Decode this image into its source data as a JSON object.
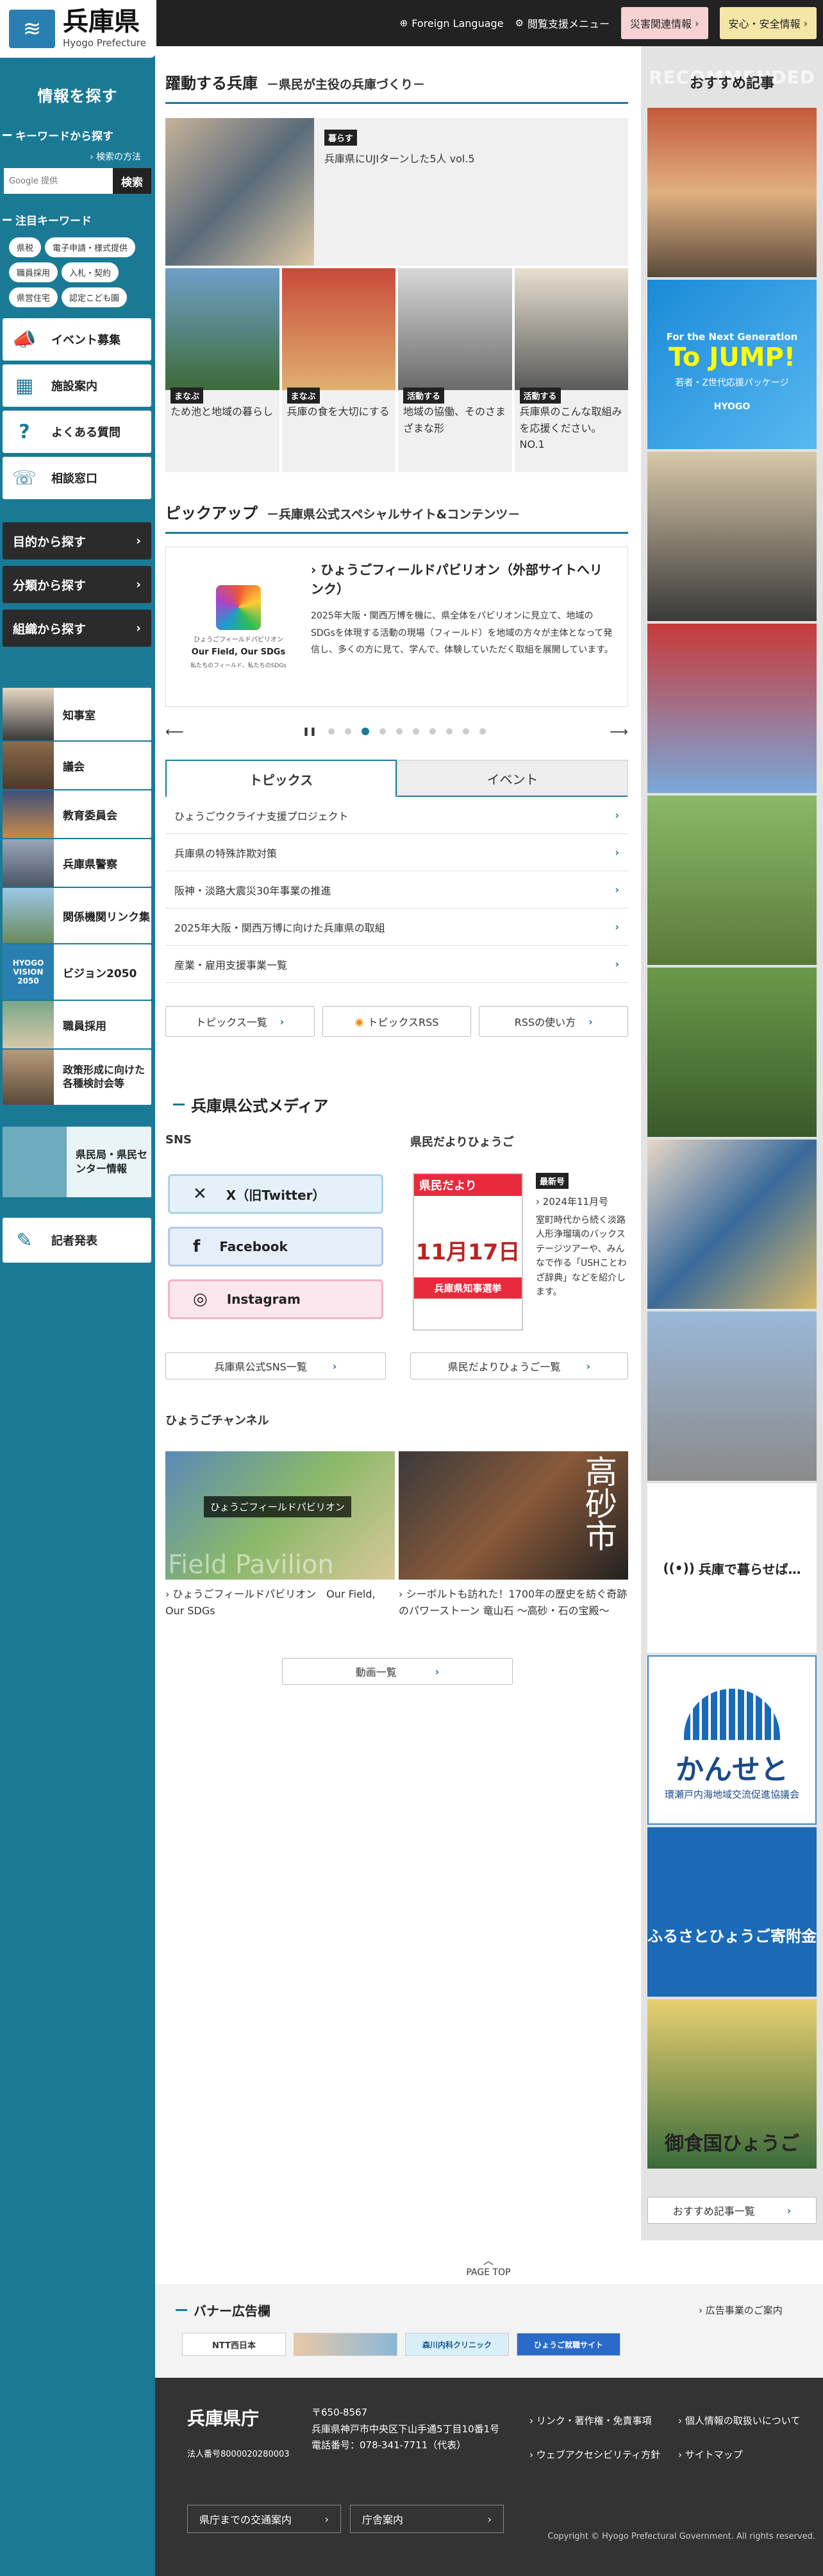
{
  "header": {
    "logo_title": "兵庫県",
    "logo_sub": "Hyogo Prefecture",
    "foreign_language": "Foreign Language",
    "reading_menu": "閲覧支援メニュー",
    "disaster_btn": "災害関連情報",
    "safety_btn": "安心・安全情報"
  },
  "sidebar": {
    "title": "情報を探す",
    "keyword_heading": "キーワードから探す",
    "search_help": "検索の方法",
    "search_placeholder": "Google 提供",
    "search_button": "検索",
    "hot_heading": "注目キーワード",
    "keywords": [
      "県税",
      "電子申請・様式提供",
      "職員採用",
      "入札・契約",
      "県営住宅",
      "認定こども園"
    ],
    "cards": [
      {
        "label": "イベント募集",
        "icon": "megaphone-icon"
      },
      {
        "label": "施設案内",
        "icon": "building-icon"
      },
      {
        "label": "よくある質問",
        "icon": "question-icon"
      },
      {
        "label": "相談窓口",
        "icon": "consult-icon"
      }
    ],
    "dark": [
      "目的から探す",
      "分類から探す",
      "組織から探す"
    ],
    "links": [
      "知事室",
      "議会",
      "教育委員会",
      "兵庫県警察",
      "関係機関リンク集",
      "ビジョン2050",
      "職員採用",
      "政策形成に向けた各種検討会等"
    ],
    "center_info": "県民局・県民センター情報",
    "press": "記者発表"
  },
  "active": {
    "heading": "躍動する兵庫",
    "subheading": "－県民が主役の兵庫づくり－",
    "feature_tag": "暮らす",
    "feature_text": "兵庫県にUJIターンした5人 vol.5",
    "items": [
      {
        "tag": "まなぶ",
        "text": "ため池と地域の暮らし"
      },
      {
        "tag": "まなぶ",
        "text": "兵庫の食を大切にする"
      },
      {
        "tag": "活動する",
        "text": "地域の協働、そのさまざまな形"
      },
      {
        "tag": "活動する",
        "text": "兵庫県のこんな取組みを応援ください。NO.1"
      }
    ]
  },
  "pickup": {
    "heading": "ピックアップ",
    "subheading": "－兵庫県公式スペシャルサイト&コンテンツ－",
    "logo_line1": "Our Field, Our SDGs",
    "logo_line2": "私たちのフィールド、私たちのSDGs",
    "logo_caption": "ひょうごフィールドパビリオン",
    "title": "ひょうごフィールドパビリオン（外部サイトへリンク）",
    "desc": "2025年大阪・関西万博を機に、県全体をパビリオンに見立て、地域のSDGsを体現する活動の現場（フィールド）を地域の方々が主体となって発信し、多くの方に見て、学んで、体験していただく取組を展開しています。"
  },
  "tabs": {
    "topics": "トピックス",
    "event": "イベント",
    "rows": [
      "ひょうごウクライナ支援プロジェクト",
      "兵庫県の特殊詐欺対策",
      "阪神・淡路大震災30年事業の推進",
      "2025年大阪・関西万博に向けた兵庫県の取組",
      "産業・雇用支援事業一覧"
    ],
    "btn_list": "トピックス一覧",
    "btn_rss": "トピックスRSS",
    "btn_rss_help": "RSSの使い方"
  },
  "media": {
    "heading": "兵庫県公式メディア",
    "sns_heading": "SNS",
    "sns": [
      "X（旧Twitter）",
      "Facebook",
      "Instagram"
    ],
    "sns_list": "兵庫県公式SNS一覧",
    "dayori_heading": "県民だよりひょうご",
    "dayori_cover_title": "県民だより",
    "dayori_cover_date": "11月17日",
    "dayori_cover_sub": "兵庫県知事選挙",
    "latest": "最新号",
    "dayori_date": "2024年11月号",
    "dayori_text": "室町時代から続く淡路人形浄瑠璃のバックステージツアーや、みんなで作る「USHことわざ辞典」などを紹介します。",
    "dayori_list": "県民だよりひょうご一覧",
    "channel_heading": "ひょうごチャンネル",
    "videos": [
      {
        "text": "ひょうごフィールドパビリオン　Our Field, Our SDGs",
        "overlay": "ひょうごフィールドパビリオン",
        "watermark": "Field Pavilion"
      },
      {
        "text": "シーボルトも訪れた！1700年の歴史を紡ぐ奇跡のパワーストーン 竜山石 〜高砂・石の宝殿〜",
        "overlay": "高砂市"
      }
    ],
    "video_list": "動画一覧"
  },
  "right": {
    "heading": "おすすめ記事",
    "heading_bg": "RECOMMENDED",
    "banner1_big": "To JUMP!",
    "banner1_small": "For the Next Generation",
    "banner1_sub": "若者・Z世代応援パッケージ",
    "banner1_brand": "HYOGO",
    "banner_kurasu": "兵庫で暮らせば…",
    "kanseto_big": "かんせと",
    "kanseto_sub": "環瀬戸内海地域交流促進協議会",
    "furusato": "ふるさとひょうご寄附金",
    "misyokuni": "御食国ひょうご",
    "more": "おすすめ記事一覧"
  },
  "footer": {
    "pagetop": "PAGE TOP",
    "banner_heading": "バナー広告欄",
    "ad_info": "広告事業のご案内",
    "ads": [
      "NTT西日本",
      "",
      "森川内科クリニック",
      "ひょうご就職サイト"
    ],
    "name": "兵庫県庁",
    "corp_no": "法人番号8000020280003",
    "zip": "〒650-8567",
    "address": "兵庫県神戸市中央区下山手通5丁目10番1号",
    "tel": "電話番号：078-341-7711（代表）",
    "links": [
      "リンク・著作権・免責事項",
      "個人情報の取扱いについて",
      "ウェブアクセシビリティ方針",
      "サイトマップ"
    ],
    "access": "県庁までの交通案内",
    "guide": "庁舎案内",
    "copyright": "Copyright © Hyogo Prefectural Government. All rights reserved."
  }
}
